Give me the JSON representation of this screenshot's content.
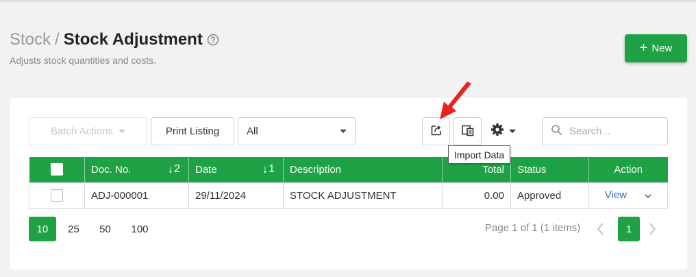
{
  "header": {
    "breadcrumb_root": "Stock",
    "breadcrumb_sep": "/",
    "title": "Stock Adjustment",
    "subtitle": "Adjusts stock quantities and costs.",
    "new_button": "New"
  },
  "toolbar": {
    "batch_actions": "Batch Actions",
    "print_listing": "Print Listing",
    "filter_value": "All",
    "search_placeholder": "Search...",
    "tooltip": "Import Data"
  },
  "table": {
    "columns": [
      "Doc. No.",
      "Date",
      "Description",
      "Total",
      "Status",
      "Action"
    ],
    "sort_docno": "2",
    "sort_date": "1",
    "rows": [
      {
        "doc_no": "ADJ-000001",
        "date": "29/11/2024",
        "description": "STOCK ADJUSTMENT",
        "total": "0.00",
        "status": "Approved",
        "action": "View"
      }
    ]
  },
  "pagination": {
    "page_sizes": [
      "10",
      "25",
      "50",
      "100"
    ],
    "active_size": "10",
    "info": "Page 1 of 1 (1 items)",
    "current_page": "1"
  },
  "colors": {
    "accent": "#1fa245",
    "link": "#2f74c0",
    "arrow": "#e8231f"
  }
}
